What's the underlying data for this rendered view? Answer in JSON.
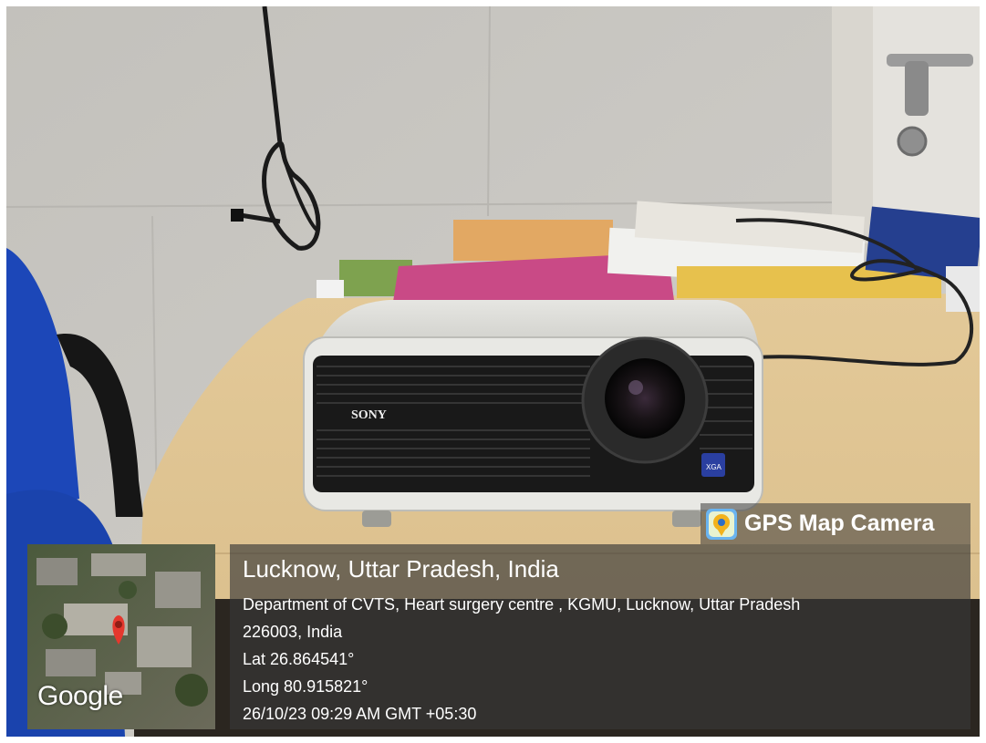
{
  "photo": {
    "subject": "projector-on-desk",
    "brand_label": "SONY",
    "badge_label": "XGA"
  },
  "overlay": {
    "app_name": "GPS Map Camera",
    "app_icon": "map-pin-icon",
    "map_logo": "Google",
    "place": "Lucknow, Uttar Pradesh, India",
    "address_line1": "Department of CVTS, Heart surgery centre , KGMU, Lucknow, Uttar Pradesh",
    "address_line2": "226003, India",
    "latitude": "Lat 26.864541°",
    "longitude": "Long 80.915821°",
    "timestamp": "26/10/23 09:29 AM GMT +05:30"
  }
}
